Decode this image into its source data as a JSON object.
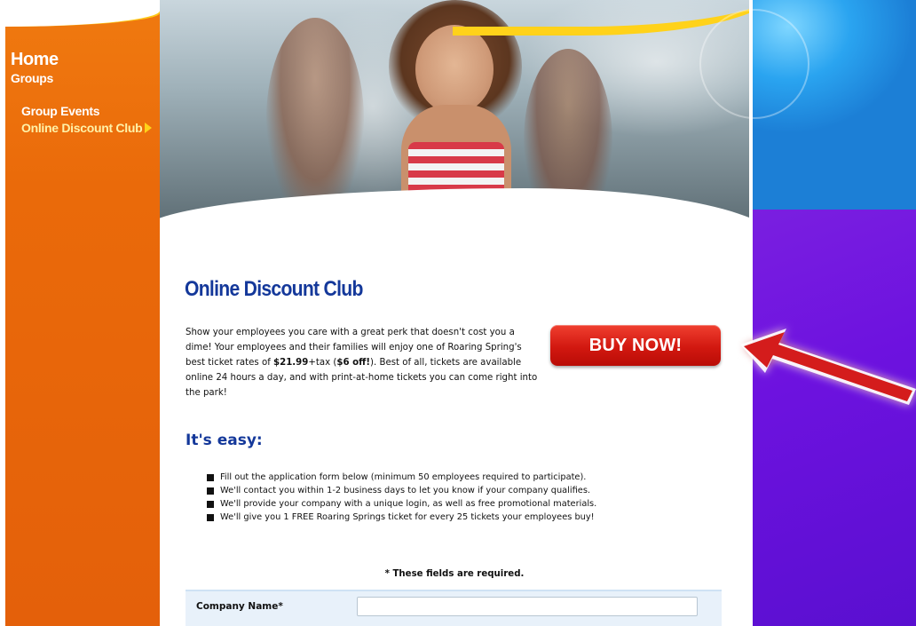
{
  "nav": {
    "home": "Home",
    "groups": "Groups",
    "group_events": "Group Events",
    "online_discount_club": "Online Discount Club"
  },
  "page": {
    "title": "Online Discount Club",
    "intro_1": "Show your employees you care with a great perk that doesn't cost you a dime!  Your employees and their families will enjoy one of Roaring Spring's best ticket rates of ",
    "price": "$21.99",
    "intro_2": "+tax (",
    "discount": "$6 off!",
    "intro_3": ").  Best of all, tickets are available online 24 hours a day, and with print-at-home tickets you can come right into the park!",
    "buy_now": "BUY NOW!",
    "easy_heading": "It's easy:",
    "steps": [
      "Fill out the application form below (minimum 50 employees required to participate).",
      "We'll contact you within 1-2 business days to let you know if your company qualifies.",
      "We'll provide your company with a unique login, as well as free promotional materials.",
      "We'll give you 1 FREE Roaring Springs ticket for every 25 tickets your employees buy!"
    ],
    "required_note": "* These fields are required.",
    "company_name_label": "Company Name*",
    "company_name_value": ""
  },
  "colors": {
    "nav_orange": "#e96a0b",
    "title_blue": "#14389a",
    "buy_red": "#d21810",
    "arrow_red": "#d41e1e",
    "side_purple": "#6d12df",
    "side_blue": "#2aa4f0"
  }
}
